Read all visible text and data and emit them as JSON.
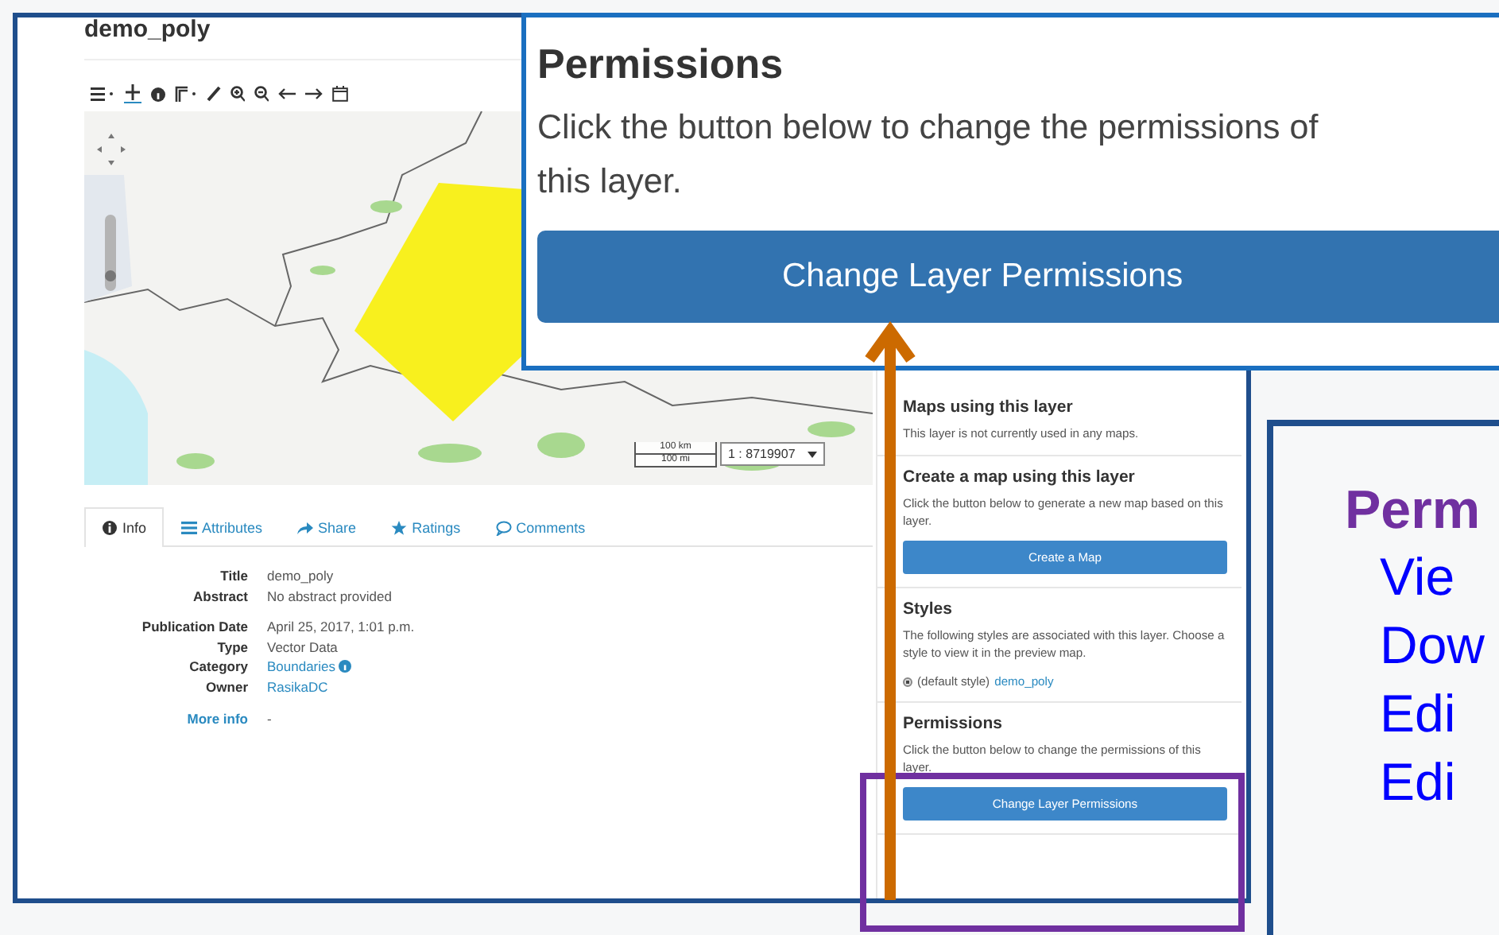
{
  "page": {
    "title": "demo_poly",
    "map": {
      "zoom": {
        "level": 0.15
      },
      "scale_top": "100 km",
      "scale_bottom": "100 mi",
      "scale_ratio": "1 : 8719907"
    },
    "tabs": [
      {
        "label": "Info",
        "selected": true
      },
      {
        "label": "Attributes",
        "selected": false
      },
      {
        "label": "Share",
        "selected": false
      },
      {
        "label": "Ratings",
        "selected": false
      },
      {
        "label": "Comments",
        "selected": false
      }
    ],
    "info_groups": [
      [
        {
          "label": "Title",
          "value": "demo_poly",
          "kind": "text"
        },
        {
          "label": "Abstract",
          "value": "No abstract provided",
          "kind": "text"
        }
      ],
      [
        {
          "label": "Publication Date",
          "value": "April 25, 2017, 1:01 p.m.",
          "kind": "text"
        },
        {
          "label": "Type",
          "value": "Vector Data",
          "kind": "text"
        },
        {
          "label": "Category",
          "value": "Boundaries",
          "kind": "link_info"
        },
        {
          "label": "Owner",
          "value": "RasikaDC",
          "kind": "link"
        }
      ]
    ],
    "more_info": {
      "label": "More info",
      "value": "-"
    },
    "sidebar": [
      {
        "kind": "plain",
        "title": "Maps using this layer",
        "text": "This layer is not currently used in any maps."
      },
      {
        "kind": "button",
        "title": "Create a map using this layer",
        "text": "Click the button below to generate a new map based on this layer.",
        "button": "Create a Map"
      },
      {
        "kind": "styles",
        "title": "Styles",
        "text": "The following styles are associated with this layer. Choose a style to view it in the preview map.",
        "style": {
          "label": "(default style)",
          "link": "demo_poly",
          "selected": true
        }
      },
      {
        "kind": "button",
        "title": "Permissions",
        "text": "Click the button below to change the permissions of this layer.",
        "button": "Change Layer Permissions"
      }
    ]
  },
  "callout": {
    "title": "Permissions",
    "text": "Click the button below to change the permissions of",
    "text_2": "this layer.",
    "button": "Change Layer Permissions"
  },
  "legend": {
    "title": "Perm",
    "items": [
      "Vie",
      "Dow",
      "Edi",
      "Edi"
    ]
  }
}
